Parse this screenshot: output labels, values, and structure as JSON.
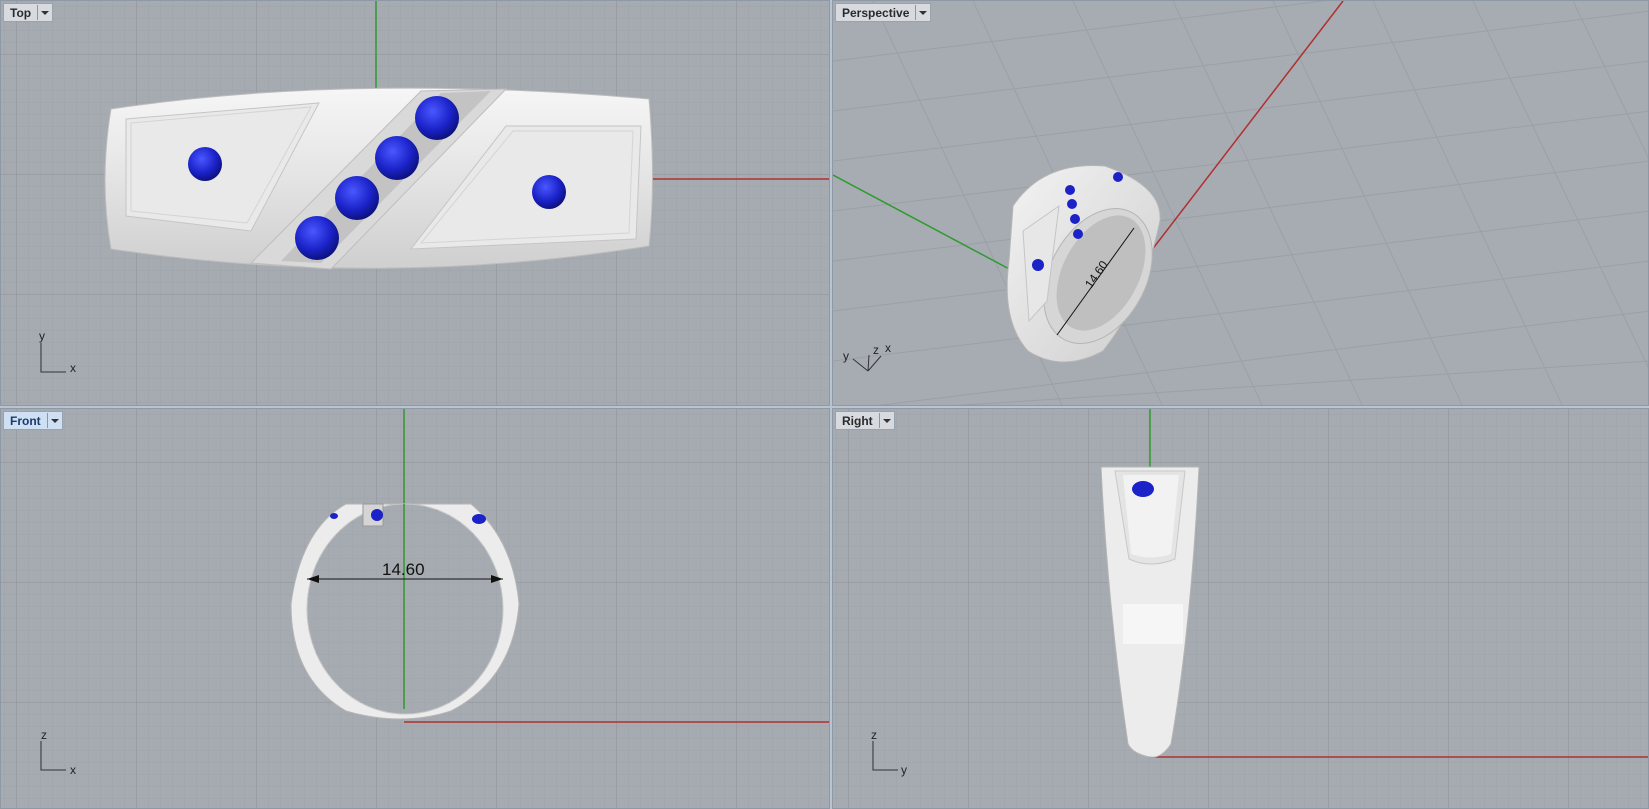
{
  "viewports": {
    "top": {
      "label": "Top",
      "axis_x": "x",
      "axis_y": "y"
    },
    "perspective": {
      "label": "Perspective",
      "axis_x": "x",
      "axis_y": "y",
      "axis_z": "z",
      "dimension": "14.60"
    },
    "front": {
      "label": "Front",
      "axis_x": "x",
      "axis_y": "z",
      "dimension": "14.60"
    },
    "right": {
      "label": "Right",
      "axis_x": "y",
      "axis_y": "z"
    }
  },
  "colors": {
    "viewport_bg": "#a6abb1",
    "grid_minor": "#9ea3a9",
    "grid_major": "#8f949a",
    "x_axis": "#b03030",
    "y_axis": "#2f9a2f",
    "gem": "#1a22c8",
    "metal": "#eeeeee"
  }
}
